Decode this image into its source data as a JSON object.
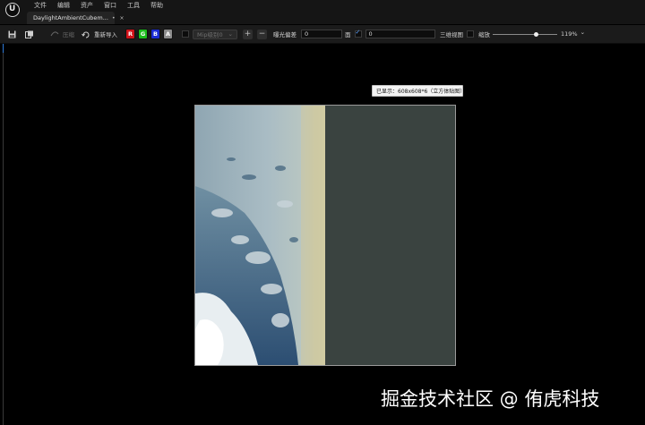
{
  "app": {
    "menu": [
      "文件",
      "编辑",
      "资产",
      "窗口",
      "工具",
      "帮助"
    ]
  },
  "tab": {
    "title": "DaylightAmbientCubem...",
    "modified_marker": "•",
    "close_glyph": "×"
  },
  "toolbar": {
    "save_icon": "save-icon",
    "browse_icon": "browse-in-content-browser-icon",
    "compress_label": "压缩",
    "reimport_label": "重新导入",
    "channels": [
      {
        "label": "R",
        "color": "#d0131a"
      },
      {
        "label": "G",
        "color": "#1bbd1b"
      },
      {
        "label": "B",
        "color": "#1b2bd4"
      },
      {
        "label": "A",
        "color": "#8c8c8c"
      }
    ],
    "mip_dropdown": "Mip级别0",
    "plus_glyph": "+",
    "minus_glyph": "−",
    "exposure_label": "曝光偏差",
    "exposure_value": "0",
    "face_label": "面",
    "face_value": "0",
    "view3d_label": "三维视图",
    "zoom_label": "缩放",
    "zoom_value": "119%",
    "zoom_chevron": "⌄",
    "zoom_slider_fraction": 0.68
  },
  "viewport": {
    "tooltip": "已显示：608x608*6（立方体贴图）"
  },
  "watermark": "掘金技术社区 @ 侑虎科技",
  "colors": {
    "accent": "#2f7bd8",
    "background": "#000000",
    "panel": "#1b1b1b"
  }
}
